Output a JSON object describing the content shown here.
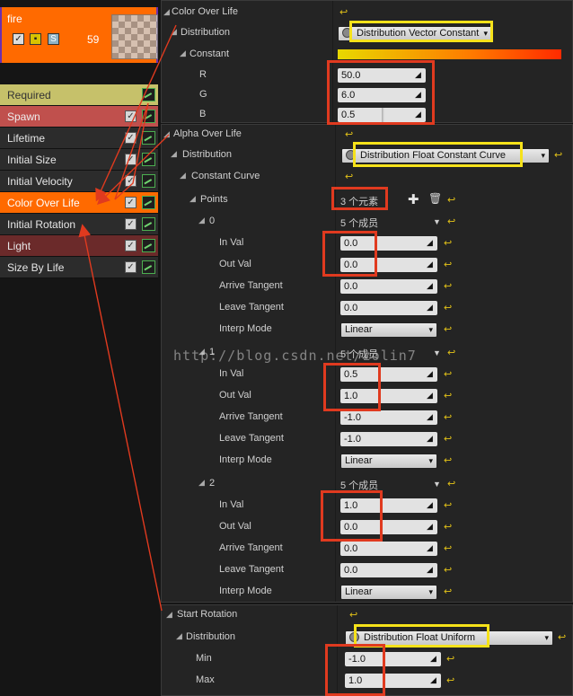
{
  "emitter": {
    "name": "fire",
    "count": "59",
    "icons": {
      "enable": "checkbox-icon",
      "solo": "solo-icon",
      "s_label": "S"
    }
  },
  "modules": [
    {
      "label": "Required",
      "bg": "#c6c16a",
      "text": "#333333",
      "check": false
    },
    {
      "label": "Spawn",
      "bg": "#c0504d",
      "text": "#eeeeee",
      "check": true
    },
    {
      "label": "Lifetime",
      "bg": "#2c2c2c",
      "text": "#e6e6e6",
      "check": true
    },
    {
      "label": "Initial Size",
      "bg": "#2c2c2c",
      "text": "#e6e6e6",
      "check": true
    },
    {
      "label": "Initial Velocity",
      "bg": "#2c2c2c",
      "text": "#e6e6e6",
      "check": true
    },
    {
      "label": "Color Over Life",
      "bg": "#ff6a00",
      "text": "#ffffff",
      "check": true
    },
    {
      "label": "Initial Rotation",
      "bg": "#2c2c2c",
      "text": "#e6e6e6",
      "check": true
    },
    {
      "label": "Light",
      "bg": "#6b2a2a",
      "text": "#e6e6e6",
      "check": true
    },
    {
      "label": "Size By Life",
      "bg": "#2c2c2c",
      "text": "#e6e6e6",
      "check": true
    }
  ],
  "color_over_life": {
    "title": "Color Over Life",
    "distribution_label": "Distribution",
    "distribution_value": "Distribution Vector Constant",
    "constant_label": "Constant",
    "r_label": "R",
    "r_value": "50.0",
    "g_label": "G",
    "g_value": "6.0",
    "b_label": "B",
    "b_value": "0.5"
  },
  "alpha_over_life": {
    "title": "Alpha Over Life",
    "distribution_label": "Distribution",
    "distribution_value": "Distribution Float Constant Curve",
    "constant_curve_label": "Constant Curve",
    "points_label": "Points",
    "points_count": "3 个元素",
    "points": [
      {
        "index": "0",
        "members": "5 个成员",
        "in_val": "0.0",
        "out_val": "0.0",
        "arrive": "0.0",
        "leave": "0.0",
        "interp": "Linear"
      },
      {
        "index": "1",
        "members": "5 个成员",
        "in_val": "0.5",
        "out_val": "1.0",
        "arrive": "-1.0",
        "leave": "-1.0",
        "interp": "Linear"
      },
      {
        "index": "2",
        "members": "5 个成员",
        "in_val": "1.0",
        "out_val": "0.0",
        "arrive": "0.0",
        "leave": "0.0",
        "interp": "Linear"
      }
    ],
    "labels": {
      "in_val": "In Val",
      "out_val": "Out Val",
      "arrive": "Arrive Tangent",
      "leave": "Leave Tangent",
      "interp": "Interp Mode"
    }
  },
  "start_rotation": {
    "title": "Start Rotation",
    "distribution_label": "Distribution",
    "distribution_value": "Distribution Float Uniform",
    "min_label": "Min",
    "min_value": "-1.0",
    "max_label": "Max",
    "max_value": "1.0"
  },
  "watermark": "http://blog.csdn.net/zolin7",
  "colors": {
    "accent_orange": "#ff6a00",
    "highlight_red": "#e03a1f",
    "highlight_yellow": "#f6e21a"
  }
}
